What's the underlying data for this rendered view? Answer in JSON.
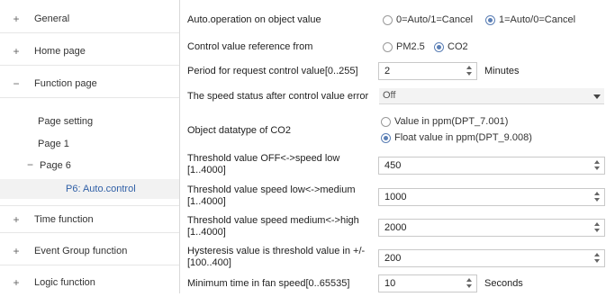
{
  "nav": {
    "general": {
      "symbol": "+",
      "label": "General"
    },
    "home_page": {
      "symbol": "+",
      "label": "Home page"
    },
    "function_page": {
      "symbol": "−",
      "label": "Function page"
    },
    "page_setting": {
      "label": "Page setting"
    },
    "page_1": {
      "label": "Page 1"
    },
    "page_6": {
      "symbol": "−",
      "label": "Page 6"
    },
    "p6_auto_control": {
      "label": "P6: Auto.control"
    },
    "time_function": {
      "symbol": "+",
      "label": "Time function"
    },
    "event_group_function": {
      "symbol": "+",
      "label": "Event Group function"
    },
    "logic_function": {
      "symbol": "+",
      "label": "Logic function"
    }
  },
  "params": {
    "auto_operation": {
      "label": "Auto.operation on object value",
      "options": [
        "0=Auto/1=Cancel",
        "1=Auto/0=Cancel"
      ],
      "selected_index": 1
    },
    "control_value_reference": {
      "label": "Control value reference from",
      "options": [
        "PM2.5",
        "CO2"
      ],
      "selected_index": 1
    },
    "request_period": {
      "label": "Period for request control value[0..255]",
      "value": "2",
      "unit": "Minutes"
    },
    "speed_status_error": {
      "label": "The speed status after control value error",
      "value": "Off"
    },
    "co2_datatype": {
      "label": "Object datatype of CO2",
      "options": [
        "Value in ppm(DPT_7.001)",
        "Float value in ppm(DPT_9.008)"
      ],
      "selected_index": 1
    },
    "threshold_off_low": {
      "label_line1": "Threshold value OFF<->speed low",
      "label_line2": "[1..4000]",
      "value": "450"
    },
    "threshold_low_medium": {
      "label_line1": "Threshold value speed low<->medium",
      "label_line2": "[1..4000]",
      "value": "1000"
    },
    "threshold_medium_high": {
      "label_line1": "Threshold value speed medium<->high",
      "label_line2": "[1..4000]",
      "value": "2000"
    },
    "hysteresis": {
      "label_line1": "Hysteresis value is threshold value in +/-",
      "label_line2": "[100..400]",
      "value": "200"
    },
    "min_time_fan_speed": {
      "label": "Minimum time in fan speed[0..65535]",
      "value": "10",
      "unit": "Seconds"
    }
  },
  "colors": {
    "selected_text": "#2f5fa6",
    "radio_selected": "#5b7fb5"
  }
}
